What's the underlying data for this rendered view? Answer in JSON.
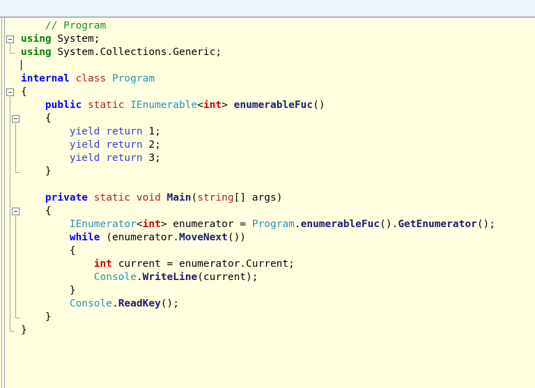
{
  "window": {
    "background_color": "#eef4fc",
    "editor_background_color": "#ffffe0",
    "top_strip_height": 25
  },
  "editor": {
    "language": "C#",
    "font": "monospace",
    "caret_line": 4,
    "colors": {
      "comment": "#1f8a3b",
      "keyword": "#0000ff",
      "keyword_using": "#008000",
      "type_keyword": "#b02020",
      "class_name": "#2b91af",
      "method_name": "#1b1b6e",
      "control_flow": "#3b3bcc",
      "primitive": "#cc0000",
      "plain_text": "#000000",
      "fold_marker": "#808080"
    },
    "fold_markers": [
      {
        "line": 2,
        "state": "expanded",
        "label": "using-block-fold"
      },
      {
        "line": 6,
        "state": "expanded",
        "label": "class-body-fold"
      },
      {
        "line": 8,
        "state": "expanded",
        "label": "enumerable-method-fold"
      },
      {
        "line": 14,
        "state": "expanded",
        "label": "main-method-fold"
      }
    ],
    "lines": [
      {
        "n": 1,
        "indent": 1,
        "tokens": [
          {
            "t": "// Program",
            "c": "comment"
          }
        ]
      },
      {
        "n": 2,
        "indent": 0,
        "tokens": [
          {
            "t": "using",
            "c": "keyword_using"
          },
          {
            "t": " System;",
            "c": "plain"
          }
        ]
      },
      {
        "n": 3,
        "indent": 0,
        "tokens": [
          {
            "t": "using",
            "c": "keyword_using"
          },
          {
            "t": " System.Collections.Generic;",
            "c": "plain"
          }
        ]
      },
      {
        "n": 4,
        "indent": 0,
        "tokens": [
          {
            "t": "",
            "c": "caret"
          }
        ]
      },
      {
        "n": 5,
        "indent": 0,
        "tokens": [
          {
            "t": "internal",
            "c": "keyword"
          },
          {
            "t": " ",
            "c": "plain"
          },
          {
            "t": "class",
            "c": "type_keyword"
          },
          {
            "t": " ",
            "c": "plain"
          },
          {
            "t": "Program",
            "c": "class"
          }
        ]
      },
      {
        "n": 6,
        "indent": 0,
        "tokens": [
          {
            "t": "{",
            "c": "plain"
          }
        ]
      },
      {
        "n": 7,
        "indent": 1,
        "tokens": [
          {
            "t": "public",
            "c": "keyword"
          },
          {
            "t": " ",
            "c": "plain"
          },
          {
            "t": "static",
            "c": "type_keyword"
          },
          {
            "t": " ",
            "c": "plain"
          },
          {
            "t": "IEnumerable",
            "c": "class"
          },
          {
            "t": "<",
            "c": "plain"
          },
          {
            "t": "int",
            "c": "primitive"
          },
          {
            "t": "> ",
            "c": "plain"
          },
          {
            "t": "enumerableFuc",
            "c": "method"
          },
          {
            "t": "()",
            "c": "plain"
          }
        ]
      },
      {
        "n": 8,
        "indent": 1,
        "tokens": [
          {
            "t": "{",
            "c": "plain"
          }
        ]
      },
      {
        "n": 9,
        "indent": 2,
        "tokens": [
          {
            "t": "yield return",
            "c": "control_flow"
          },
          {
            "t": " 1;",
            "c": "plain"
          }
        ]
      },
      {
        "n": 10,
        "indent": 2,
        "tokens": [
          {
            "t": "yield return",
            "c": "control_flow"
          },
          {
            "t": " 2;",
            "c": "plain"
          }
        ]
      },
      {
        "n": 11,
        "indent": 2,
        "tokens": [
          {
            "t": "yield return",
            "c": "control_flow"
          },
          {
            "t": " 3;",
            "c": "plain"
          }
        ]
      },
      {
        "n": 12,
        "indent": 1,
        "tokens": [
          {
            "t": "}",
            "c": "plain"
          }
        ]
      },
      {
        "n": 13,
        "indent": 0,
        "tokens": []
      },
      {
        "n": 14,
        "indent": 1,
        "tokens": [
          {
            "t": "private",
            "c": "keyword"
          },
          {
            "t": " ",
            "c": "plain"
          },
          {
            "t": "static",
            "c": "type_keyword"
          },
          {
            "t": " ",
            "c": "plain"
          },
          {
            "t": "void",
            "c": "type_keyword"
          },
          {
            "t": " ",
            "c": "plain"
          },
          {
            "t": "Main",
            "c": "method"
          },
          {
            "t": "(",
            "c": "plain"
          },
          {
            "t": "string",
            "c": "type_keyword"
          },
          {
            "t": "[] args)",
            "c": "plain"
          }
        ]
      },
      {
        "n": 15,
        "indent": 1,
        "tokens": [
          {
            "t": "{",
            "c": "plain"
          }
        ]
      },
      {
        "n": 16,
        "indent": 2,
        "tokens": [
          {
            "t": "IEnumerator",
            "c": "class"
          },
          {
            "t": "<",
            "c": "plain"
          },
          {
            "t": "int",
            "c": "primitive"
          },
          {
            "t": "> enumerator = ",
            "c": "plain"
          },
          {
            "t": "Program",
            "c": "class"
          },
          {
            "t": ".",
            "c": "plain"
          },
          {
            "t": "enumerableFuc",
            "c": "method"
          },
          {
            "t": "().",
            "c": "plain"
          },
          {
            "t": "GetEnumerator",
            "c": "method"
          },
          {
            "t": "();",
            "c": "plain"
          }
        ]
      },
      {
        "n": 17,
        "indent": 2,
        "tokens": [
          {
            "t": "while",
            "c": "keyword"
          },
          {
            "t": " (enumerator.",
            "c": "plain"
          },
          {
            "t": "MoveNext",
            "c": "method"
          },
          {
            "t": "())",
            "c": "plain"
          }
        ]
      },
      {
        "n": 18,
        "indent": 2,
        "tokens": [
          {
            "t": "{",
            "c": "plain"
          }
        ]
      },
      {
        "n": 19,
        "indent": 3,
        "tokens": [
          {
            "t": "int",
            "c": "primitive"
          },
          {
            "t": " current = enumerator.Current;",
            "c": "plain"
          }
        ]
      },
      {
        "n": 20,
        "indent": 3,
        "tokens": [
          {
            "t": "Console",
            "c": "class"
          },
          {
            "t": ".",
            "c": "plain"
          },
          {
            "t": "WriteLine",
            "c": "method"
          },
          {
            "t": "(current);",
            "c": "plain"
          }
        ]
      },
      {
        "n": 21,
        "indent": 2,
        "tokens": [
          {
            "t": "}",
            "c": "plain"
          }
        ]
      },
      {
        "n": 22,
        "indent": 2,
        "tokens": [
          {
            "t": "Console",
            "c": "class"
          },
          {
            "t": ".",
            "c": "plain"
          },
          {
            "t": "ReadKey",
            "c": "method"
          },
          {
            "t": "();",
            "c": "plain"
          }
        ]
      },
      {
        "n": 23,
        "indent": 1,
        "tokens": [
          {
            "t": "}",
            "c": "plain"
          }
        ]
      },
      {
        "n": 24,
        "indent": 0,
        "tokens": [
          {
            "t": "}",
            "c": "plain"
          }
        ]
      }
    ]
  }
}
